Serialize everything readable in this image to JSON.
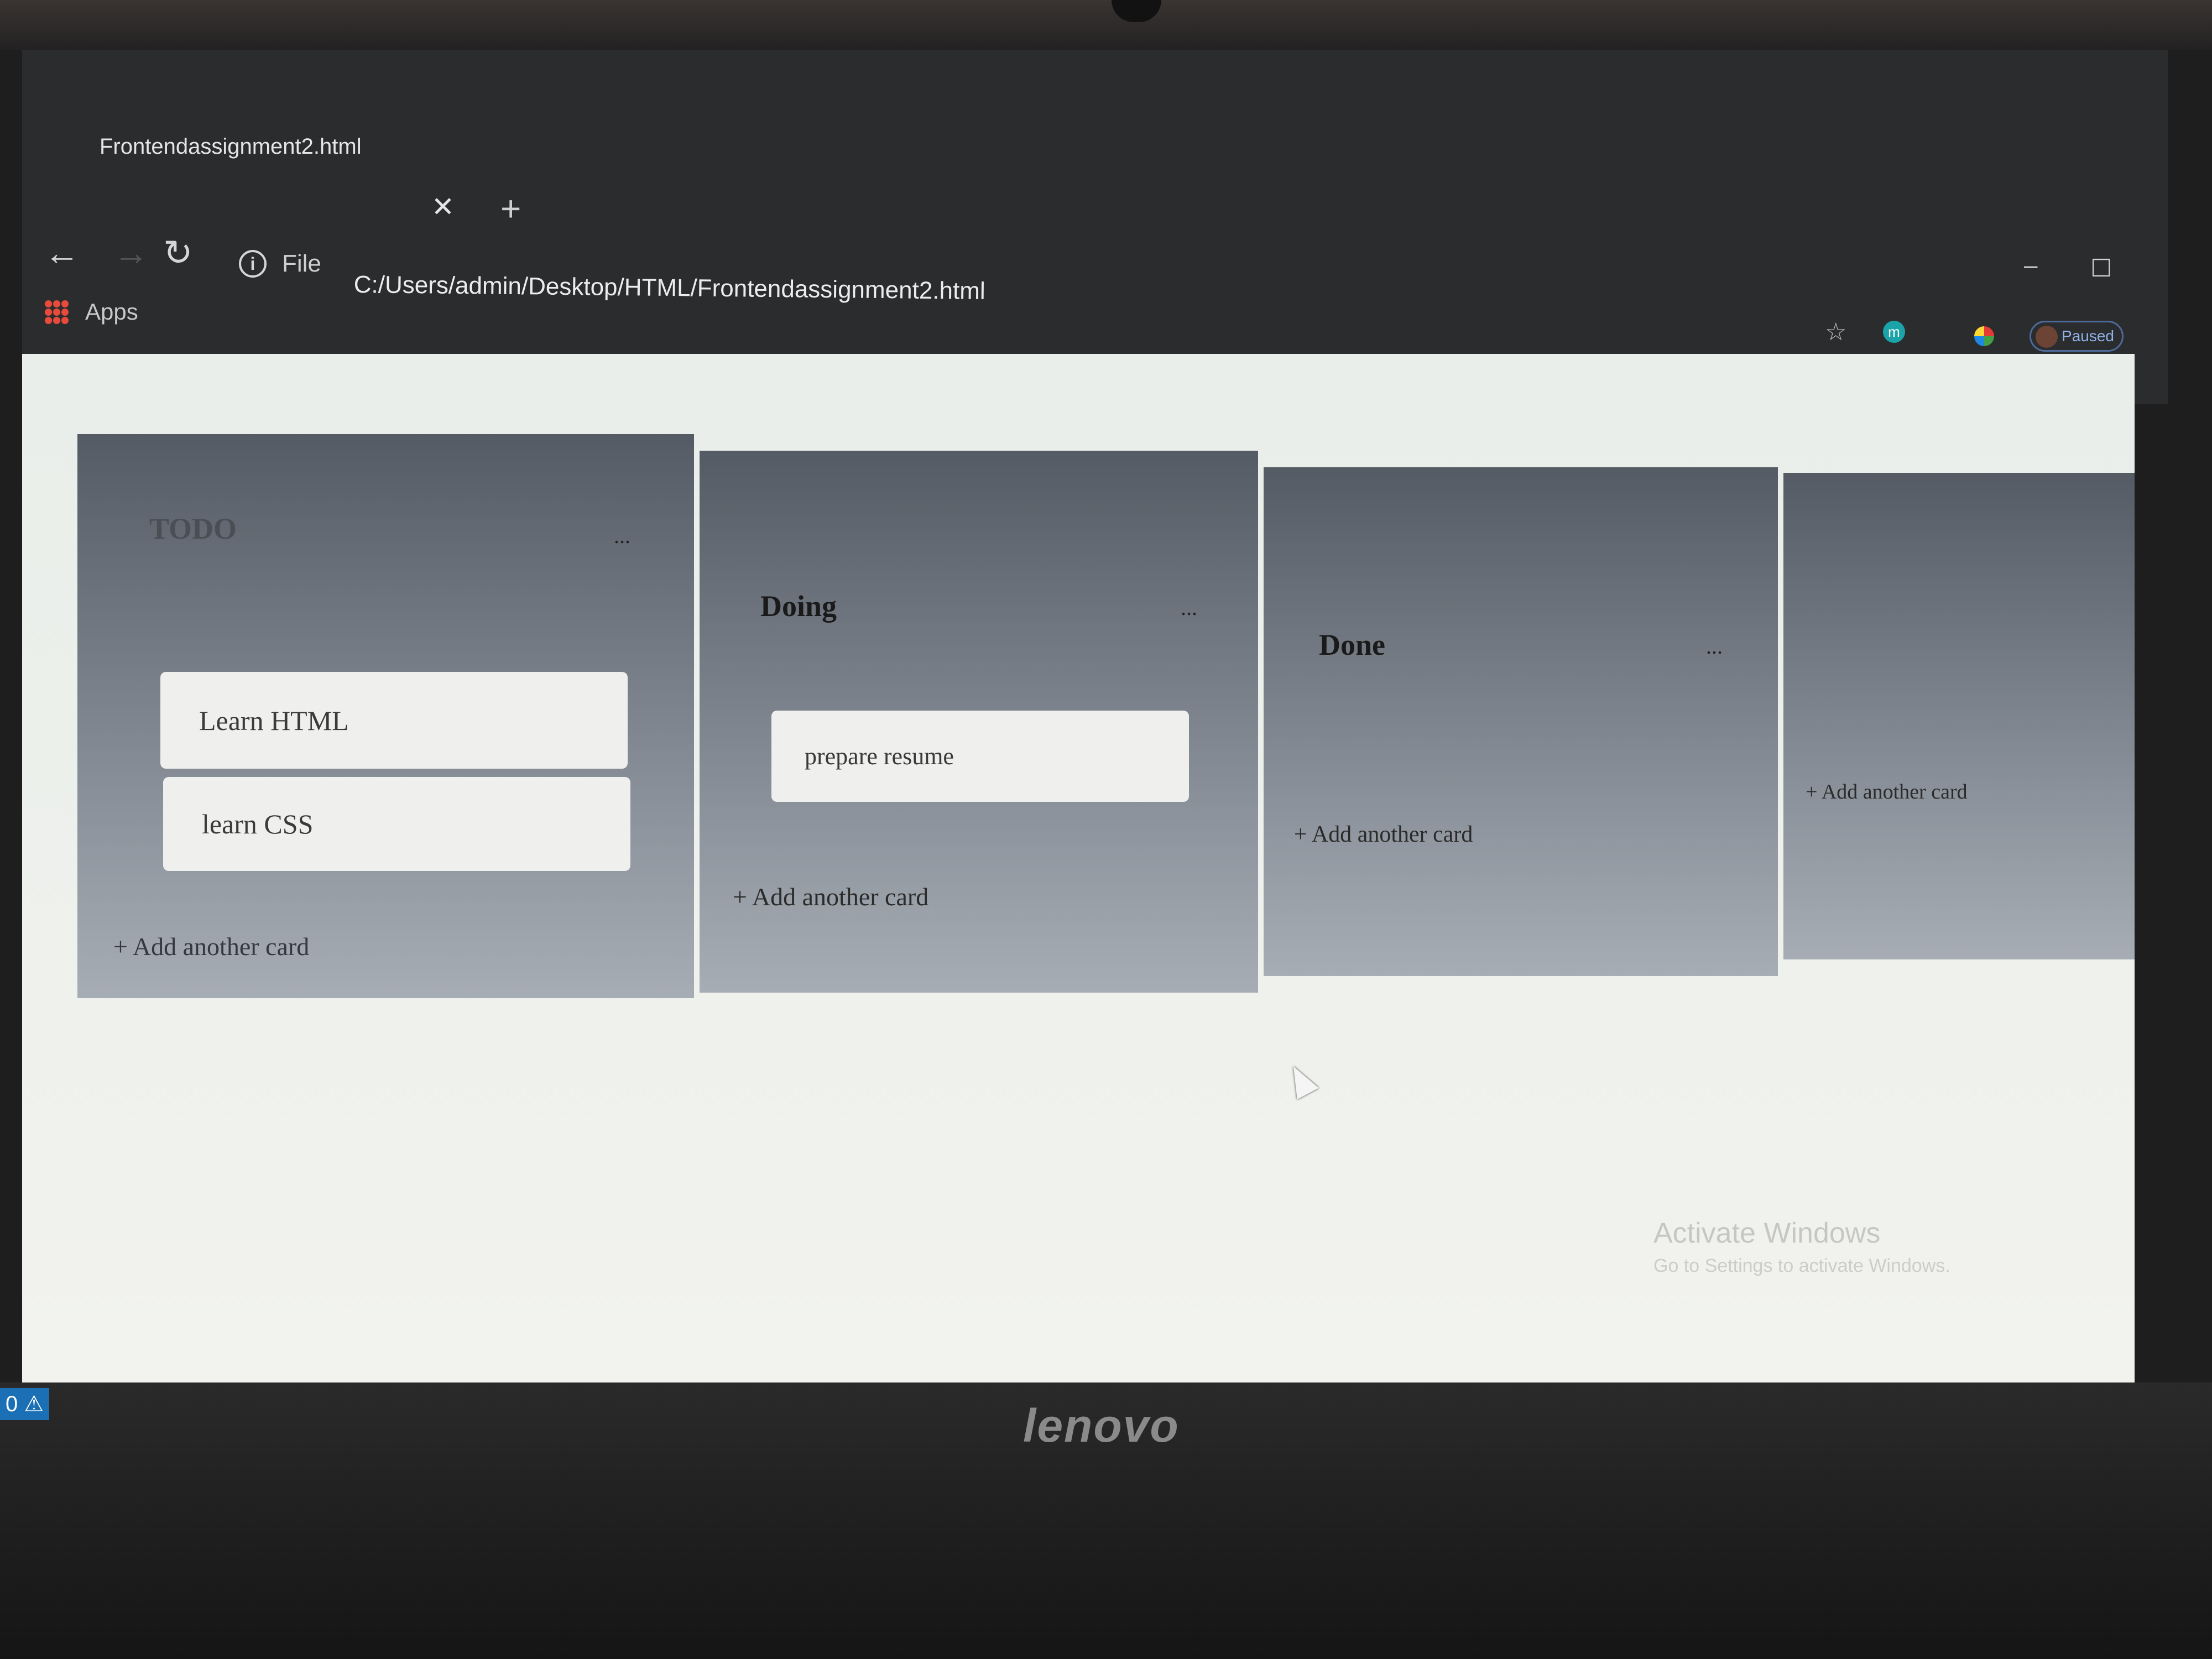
{
  "browser": {
    "tab_title": "Frontendassignment2.html",
    "tab_close": "✕",
    "new_tab": "+",
    "back": "←",
    "forward": "→",
    "reload": "↻",
    "info": "i",
    "file_label": "File",
    "url": "C:/Users/admin/Desktop/HTML/Frontendassignment2.html",
    "apps_label": "Apps",
    "star": "☆",
    "extension_letter": "m",
    "profile_status": "Paused",
    "minimize": "–",
    "maximize": "☐"
  },
  "board": {
    "lists": [
      {
        "title": "TODO",
        "menu": "...",
        "cards": [
          "Learn HTML",
          "learn CSS"
        ],
        "add_card": "+ Add another card"
      },
      {
        "title": "Doing",
        "menu": "...",
        "cards": [
          "prepare resume"
        ],
        "add_card": "+ Add another card"
      },
      {
        "title": "Done",
        "menu": "...",
        "cards": [],
        "add_card": "+ Add another card"
      },
      {
        "title": "",
        "cards": [],
        "add_card": "+ Add another card"
      }
    ]
  },
  "overlay": {
    "watermark": "Activate Windows",
    "watermark_sub": "Go to Settings to activate Windows."
  },
  "device": {
    "brand": "lenovo",
    "taskbar_badge": "0 ⚠"
  }
}
